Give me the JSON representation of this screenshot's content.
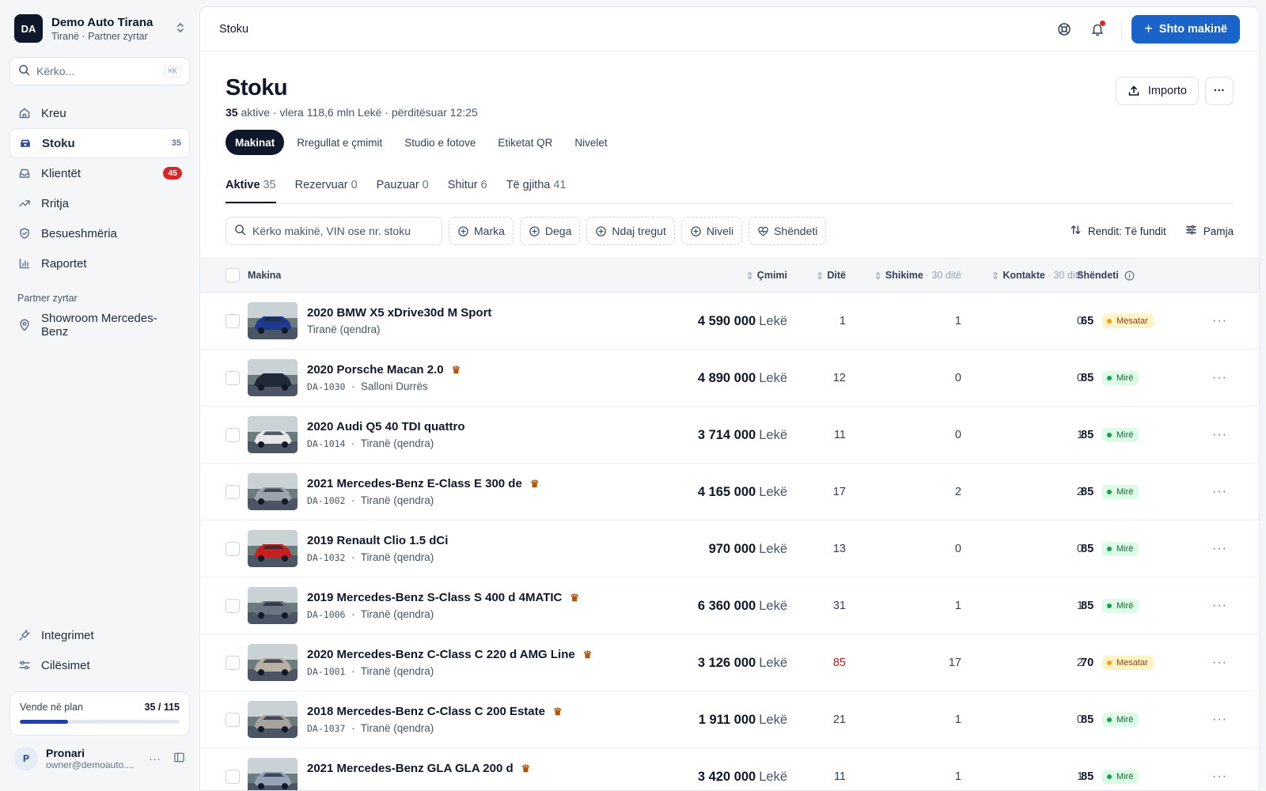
{
  "org": {
    "initials": "DA",
    "name": "Demo Auto Tirana",
    "subtitle": "Tiranë · Partner zyrtar"
  },
  "sidebar_search": {
    "placeholder": "Kërko...",
    "shortcut": "⌘K"
  },
  "nav": [
    {
      "label": "Kreu",
      "icon": "home-icon"
    },
    {
      "label": "Stoku",
      "icon": "car-icon",
      "count": "35",
      "active": true
    },
    {
      "label": "Klientët",
      "icon": "inbox-icon",
      "badge": "45"
    },
    {
      "label": "Rritja",
      "icon": "trending-up-icon"
    },
    {
      "label": "Besueshmëria",
      "icon": "shield-icon"
    },
    {
      "label": "Raportet",
      "icon": "bar-chart-icon"
    }
  ],
  "partner_section": {
    "label": "Partner zyrtar",
    "item": "Showroom Mercedes-Benz"
  },
  "bottom_nav": [
    {
      "label": "Integrimet",
      "icon": "plug-icon"
    },
    {
      "label": "Cilësimet",
      "icon": "sliders-icon"
    }
  ],
  "plan": {
    "label": "Vende në plan",
    "value": "35 / 115",
    "used": 35,
    "total": 115
  },
  "user": {
    "initial": "P",
    "name": "Pronari",
    "email": "owner@demoauto...."
  },
  "topbar": {
    "breadcrumb": "Stoku",
    "primary_label": "Shto makinë"
  },
  "page": {
    "title": "Stoku",
    "sub_count": "35",
    "sub_rest": " aktive · vlera 118,6 mln Lekë · përditësuar 12:25",
    "import_label": "Importo"
  },
  "pills": [
    "Makinat",
    "Rregullat e çmimit",
    "Studio e fotove",
    "Etiketat QR",
    "Nivelet"
  ],
  "tabs": [
    {
      "label": "Aktive",
      "count": "35"
    },
    {
      "label": "Rezervuar",
      "count": "0"
    },
    {
      "label": "Pauzuar",
      "count": "0"
    },
    {
      "label": "Shitur",
      "count": "6"
    },
    {
      "label": "Të gjitha",
      "count": "41"
    }
  ],
  "filters": {
    "search_placeholder": "Kërko makinë, VIN ose nr. stoku",
    "chips": [
      "Marka",
      "Dega",
      "Ndaj tregut",
      "Niveli",
      "Shëndeti"
    ],
    "sort_label": "Rendit: Të fundit",
    "view_label": "Pamja"
  },
  "columns": {
    "car": "Makina",
    "price": "Çmimi",
    "days": "Ditë",
    "views": "Shikime",
    "views_sub": "· 30 ditë",
    "contacts": "Kontakte",
    "contacts_sub": "· 30 ditë",
    "health": "Shëndeti"
  },
  "rows": [
    {
      "name": "2020 BMW X5 xDrive30d M Sport",
      "stock": "",
      "location": "Tiranë (qendra)",
      "premium": false,
      "price": "4 590 000",
      "currency": "Lekë",
      "days": "1",
      "views": "1",
      "contacts": "0",
      "health": "65",
      "status": "Mesatar",
      "kind": "avg",
      "color": "#1d3a8f"
    },
    {
      "name": "2020 Porsche Macan 2.0",
      "stock": "DA-1030",
      "location": "Salloni Durrës",
      "premium": true,
      "price": "4 890 000",
      "currency": "Lekë",
      "days": "12",
      "views": "0",
      "contacts": "0",
      "health": "85",
      "status": "Mirë",
      "kind": "good",
      "color": "#1f2937"
    },
    {
      "name": "2020 Audi Q5 40 TDI quattro",
      "stock": "DA-1014",
      "location": "Tiranë (qendra)",
      "premium": false,
      "price": "3 714 000",
      "currency": "Lekë",
      "days": "11",
      "views": "0",
      "contacts": "1",
      "health": "85",
      "status": "Mirë",
      "kind": "good",
      "color": "#e5e7eb"
    },
    {
      "name": "2021 Mercedes-Benz E-Class E 300 de",
      "stock": "DA-1002",
      "location": "Tiranë (qendra)",
      "premium": true,
      "price": "4 165 000",
      "currency": "Lekë",
      "days": "17",
      "views": "2",
      "contacts": "2",
      "health": "85",
      "status": "Mirë",
      "kind": "good",
      "color": "#9ca3af"
    },
    {
      "name": "2019 Renault Clio 1.5 dCi",
      "stock": "DA-1032",
      "location": "Tiranë (qendra)",
      "premium": false,
      "price": "970 000",
      "currency": "Lekë",
      "days": "13",
      "views": "0",
      "contacts": "0",
      "health": "85",
      "status": "Mirë",
      "kind": "good",
      "color": "#c81e1e"
    },
    {
      "name": "2019 Mercedes-Benz S-Class S 400 d 4MATIC",
      "stock": "DA-1006",
      "location": "Tiranë (qendra)",
      "premium": true,
      "price": "6 360 000",
      "currency": "Lekë",
      "days": "31",
      "views": "1",
      "contacts": "1",
      "health": "85",
      "status": "Mirë",
      "kind": "good",
      "color": "#6b7280"
    },
    {
      "name": "2020 Mercedes-Benz C-Class C 220 d AMG Line",
      "stock": "DA-1001",
      "location": "Tiranë (qendra)",
      "premium": true,
      "price": "3 126 000",
      "currency": "Lekë",
      "days": "85",
      "days_alert": true,
      "views": "17",
      "contacts": "2",
      "health": "70",
      "status": "Mesatar",
      "kind": "avg",
      "color": "#b8b0a2"
    },
    {
      "name": "2018 Mercedes-Benz C-Class C 200 Estate",
      "stock": "DA-1037",
      "location": "Tiranë (qendra)",
      "premium": true,
      "price": "1 911 000",
      "currency": "Lekë",
      "days": "21",
      "views": "1",
      "contacts": "0",
      "health": "85",
      "status": "Mirë",
      "kind": "good",
      "color": "#a8a29e"
    },
    {
      "name": "2021 Mercedes-Benz GLA GLA 200 d",
      "stock": "",
      "location": "",
      "premium": true,
      "price": "3 420 000",
      "currency": "Lekë",
      "days": "11",
      "views": "1",
      "contacts": "1",
      "health": "85",
      "status": "Mirë",
      "kind": "good",
      "color": "#94a3b8"
    }
  ]
}
